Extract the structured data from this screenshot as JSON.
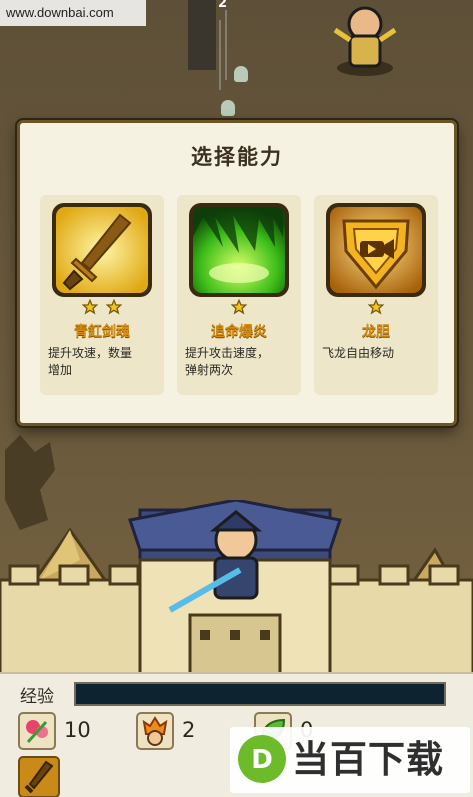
{
  "watermark_top": "www.downbai.com",
  "top_counter": "2",
  "modal": {
    "title": "选择能力",
    "cards": [
      {
        "icon": "sword-icon",
        "stars": 2,
        "name": "青釭剑魂",
        "desc_line1": "提升攻速，数量",
        "desc_line2": "增加"
      },
      {
        "icon": "green-flame-icon",
        "stars": 1,
        "name": "追命爆炎",
        "desc_line1": "提升攻击速度，",
        "desc_line2": "弹射两次"
      },
      {
        "icon": "dragon-shield-video-icon",
        "stars": 1,
        "name": "龙胆",
        "desc_line1": "飞龙自由移动",
        "desc_line2": ""
      }
    ]
  },
  "hud": {
    "exp_label": "经验",
    "exp_progress": 0,
    "resources": [
      {
        "icon": "flower-icon",
        "value": "10"
      },
      {
        "icon": "fire-demon-icon",
        "value": "2"
      },
      {
        "icon": "green-leaf-icon",
        "value": "0"
      }
    ],
    "skill_slot_icon": "sword-skill-icon"
  },
  "watermark_bottom": {
    "logo_letter": "D",
    "text": "当百下载"
  },
  "colors": {
    "card_name": "#d68f12",
    "modal_border": "#6b5628",
    "exp_bar": "#0d2430"
  }
}
